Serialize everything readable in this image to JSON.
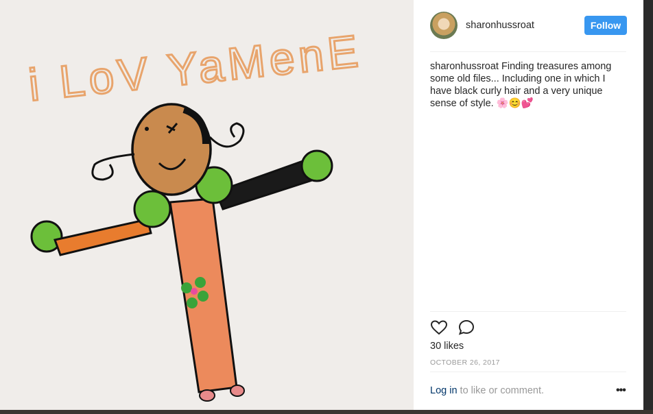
{
  "post": {
    "image_alt": "Child's drawing of a smiling girl with curly hair",
    "drawing_text": "i LoV YaMenE"
  },
  "header": {
    "username": "sharonhussroat",
    "follow_label": "Follow"
  },
  "caption": {
    "username": "sharonhussroat",
    "text": "Finding treasures among some old files... Including one in which I have black curly hair and a very unique sense of style. 🌸😊💕"
  },
  "actions": {
    "like_icon": "heart-icon",
    "comment_icon": "comment-icon"
  },
  "likes": "30 likes",
  "date": "OCTOBER 26, 2017",
  "footer": {
    "login_label": "Log in",
    "login_rest": " to like or comment.",
    "more_label": "•••"
  },
  "colors": {
    "follow_bg": "#3897f0",
    "link": "#003569",
    "muted": "#999999"
  }
}
